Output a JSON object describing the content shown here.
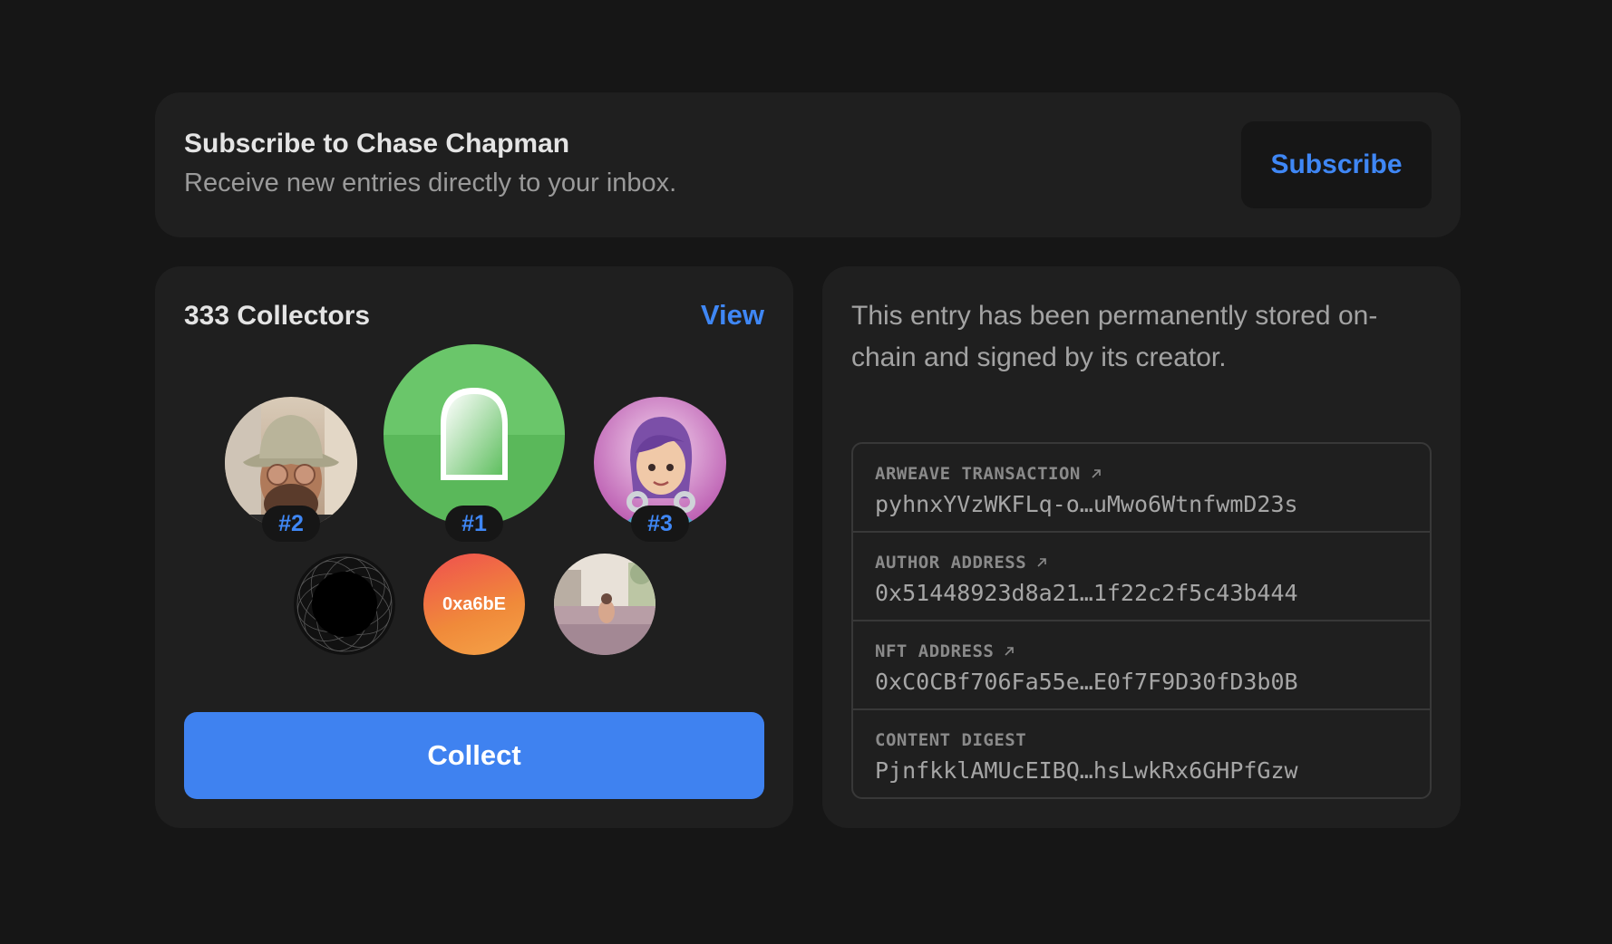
{
  "subscribe": {
    "title": "Subscribe to Chase Chapman",
    "description": "Receive new entries directly to your inbox.",
    "button_label": "Subscribe"
  },
  "collectors": {
    "title": "333 Collectors",
    "view_label": "View",
    "top": [
      {
        "rank": "#2",
        "avatar": "bucket-hat-person-avatar"
      },
      {
        "rank": "#1",
        "avatar": "green-arch-avatar"
      },
      {
        "rank": "#3",
        "avatar": "purple-hair-3d-avatar"
      }
    ],
    "others": [
      {
        "avatar": "black-circle-avatar"
      },
      {
        "avatar": "gradient-address-avatar",
        "label": "0xa6bE"
      },
      {
        "avatar": "pool-photo-avatar"
      }
    ],
    "collect_label": "Collect"
  },
  "provenance": {
    "text": "This entry has been permanently stored on-chain and signed by its creator.",
    "rows": [
      {
        "label": "ARWEAVE TRANSACTION",
        "value": "pyhnxYVzWKFLq-o…uMwo6WtnfwmD23s",
        "external": true
      },
      {
        "label": "AUTHOR ADDRESS",
        "value": "0x51448923d8a21…1f22c2f5c43b444",
        "external": true
      },
      {
        "label": "NFT ADDRESS",
        "value": "0xC0CBf706Fa55e…E0f7F9D30fD3b0B",
        "external": true
      },
      {
        "label": "CONTENT DIGEST",
        "value": "PjnfkklAMUcEIBQ…hsLwkRx6GHPfGzw",
        "external": false
      }
    ]
  },
  "colors": {
    "background": "#161616",
    "card": "#1f1f1f",
    "accent": "#3f87f5",
    "collect_button": "#3f82f0"
  }
}
